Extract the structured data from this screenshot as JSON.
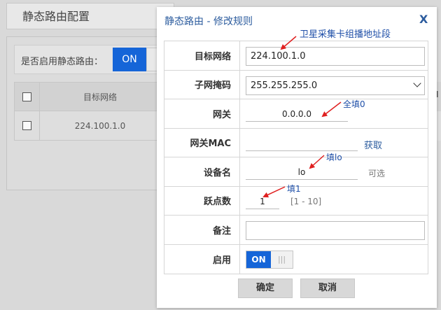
{
  "background": {
    "page_title": "静态路由配置",
    "enable_label": "是否启用静态路由：",
    "enable_state": "ON",
    "table_header": "目标网络",
    "table_rows": [
      "224.100.1.0"
    ],
    "cut_header_text": "I"
  },
  "dialog": {
    "title": "静态路由 - 修改规则",
    "close": "X",
    "fields": {
      "dest_label": "目标网络",
      "dest_value": "224.100.1.0",
      "mask_label": "子网掩码",
      "mask_value": "255.255.255.0",
      "gateway_label": "网关",
      "gateway_value": "0.0.0.0",
      "gwmac_label": "网关MAC",
      "gwmac_value": "",
      "gwmac_fetch": "获取",
      "device_label": "设备名",
      "device_value": "lo",
      "device_hint": "可选",
      "hop_label": "跃点数",
      "hop_value": "1",
      "hop_range": "[1 - 10]",
      "note_label": "备注",
      "note_value": "",
      "enable_label": "启用",
      "enable_on": "ON",
      "enable_off": "|||"
    },
    "buttons": {
      "ok": "确定",
      "cancel": "取消"
    }
  },
  "annotations": {
    "dest": "卫星采集卡组播地址段",
    "gateway": "全填0",
    "device": "填lo",
    "hop": "填1",
    "color": "#1f4fa8",
    "arrow_color": "#e02020"
  },
  "colors": {
    "accent": "#1565d8",
    "title_blue": "#2c5c9e"
  }
}
